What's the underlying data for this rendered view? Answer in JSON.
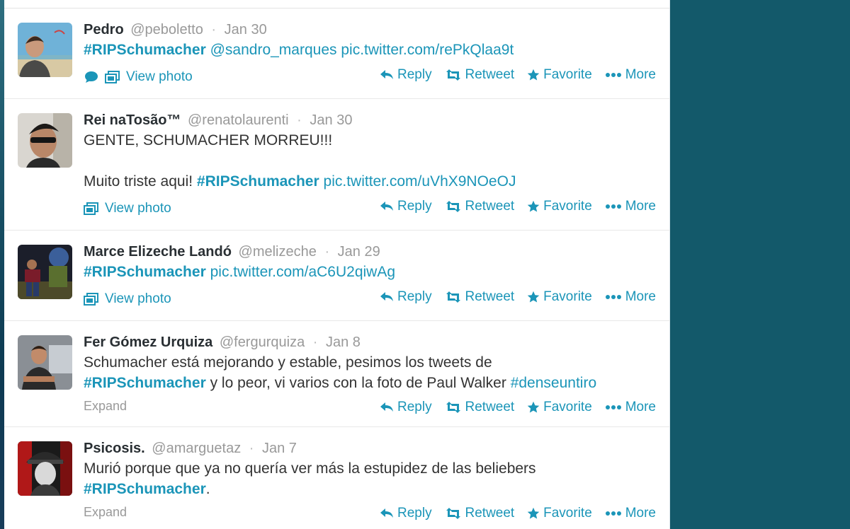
{
  "actions": {
    "reply": "Reply",
    "retweet": "Retweet",
    "favorite": "Favorite",
    "more": "More"
  },
  "labels": {
    "view_photo": "View photo",
    "expand": "Expand"
  },
  "colors": {
    "link": "#1b95b8",
    "background": "#13596a"
  },
  "tweets": [
    {
      "name": "Pedro",
      "username": "@peboletto",
      "date": "Jan 30",
      "line1": {
        "hashtag": "#RIPSchumacher",
        "mention": "@sandro_marques",
        "pic": "pic.twitter.com/rePkQlaa9t"
      }
    },
    {
      "name": "Rei naTosão™",
      "username": "@renatolaurenti",
      "date": "Jan 30",
      "line1": "GENTE, SCHUMACHER MORREU!!!",
      "line2": {
        "text": "Muito triste aqui!",
        "hashtag": "#RIPSchumacher",
        "pic": "pic.twitter.com/uVhX9NOeOJ"
      }
    },
    {
      "name": "Marce Elizeche Landó",
      "username": "@melizeche",
      "date": "Jan 29",
      "line1": {
        "hashtag": "#RIPSchumacher",
        "pic": "pic.twitter.com/aC6U2qiwAg"
      }
    },
    {
      "name": "Fer Gómez Urquiza",
      "username": "@fergurquiza",
      "date": "Jan 8",
      "line1": "Schumacher está mejorando y estable, pesimos los tweets de",
      "line2": {
        "hashtag": "#RIPSchumacher",
        "text": "y lo peor, vi varios con la foto de Paul Walker",
        "hashtag2": "#denseuntiro"
      }
    },
    {
      "name": "Psicosis.",
      "username": "@amarguetaz",
      "date": "Jan 7",
      "line1": "Murió porque que ya no quería ver más la estupidez de las beliebers",
      "line2": {
        "hashtag": "#RIPSchumacher",
        "text": "."
      }
    }
  ]
}
